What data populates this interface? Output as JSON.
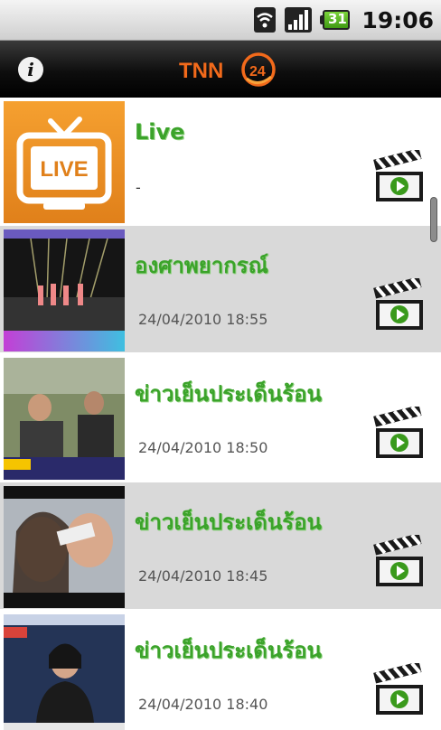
{
  "status_bar": {
    "time": "19:06",
    "battery_level": "31",
    "icons": [
      "wifi-icon",
      "signal-icon",
      "battery-icon"
    ]
  },
  "app_bar": {
    "logo_text": "TNN",
    "logo_badge": "24",
    "info_icon": "i"
  },
  "items": [
    {
      "title": "Live",
      "date": "-",
      "thumb": "live-tv-thumbnail"
    },
    {
      "title": "องศาพยากรณ์",
      "date": "24/04/2010 18:55",
      "thumb": "stage-performance-thumbnail"
    },
    {
      "title": "ข่าวเย็นประเด็นร้อน",
      "date": "24/04/2010 18:50",
      "thumb": "news-men-thumbnail"
    },
    {
      "title": "ข่าวเย็นประเด็นร้อน",
      "date": "24/04/2010 18:45",
      "thumb": "advert-thumbnail"
    },
    {
      "title": "ข่าวเย็นประเด็นร้อน",
      "date": "24/04/2010 18:40",
      "thumb": "news-anchor-thumbnail"
    }
  ],
  "colors": {
    "title_green": "#3ba32a",
    "row_gray": "#d9d9d9",
    "logo_orange": "#f26a1b"
  }
}
